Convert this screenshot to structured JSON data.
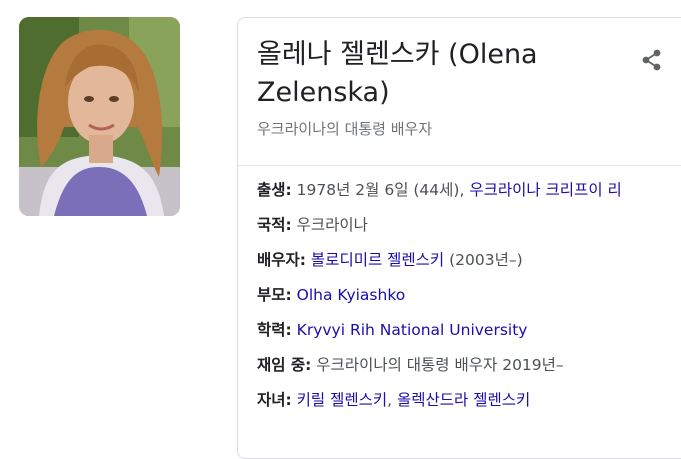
{
  "profile": {
    "photo_icon": "person-photo",
    "title": "올레나 젤렌스카 (Olena Zelenska)",
    "subtitle": "우크라이나의 대통령 배우자",
    "share_icon": "share-icon"
  },
  "facts": {
    "birth": {
      "label": "출생:",
      "text": " 1978년 2월 6일 (44세), ",
      "link": "우크라이나 크리프이 리"
    },
    "nationality": {
      "label": "국적:",
      "text": " 우크라이나"
    },
    "spouse": {
      "label": "배우자:",
      "link": "볼로디미르 젤렌스키",
      "text": " (2003년–)"
    },
    "parents": {
      "label": "부모:",
      "link": "Olha Kyiashko"
    },
    "education": {
      "label": "학력:",
      "link": "Kryvyi Rih National University"
    },
    "in_office": {
      "label": "재임 중:",
      "text": " 우크라이나의 대통령 배우자 2019년–"
    },
    "children": {
      "label": "자녀:",
      "link1": "키릴 젤렌스키",
      "sep": ", ",
      "link2": "올렉산드라 젤렌스키"
    }
  },
  "colors": {
    "link": "#1a0dab",
    "muted": "#70757a",
    "border": "#dadce0"
  }
}
